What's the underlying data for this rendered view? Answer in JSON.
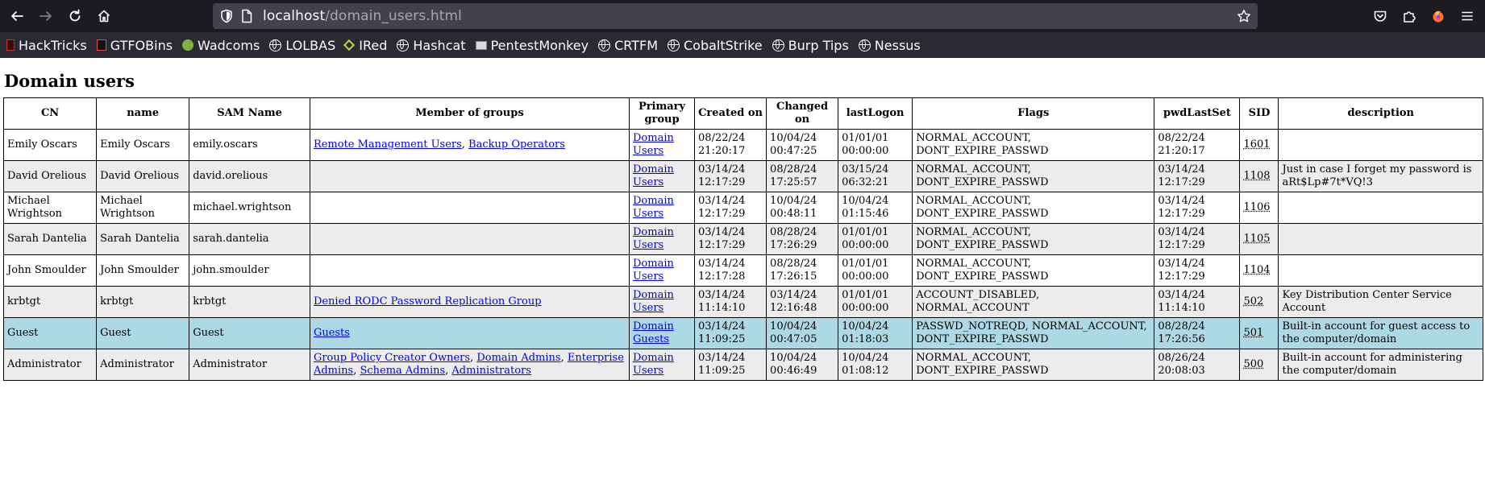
{
  "browser": {
    "url_host": "localhost",
    "url_path": "/domain_users.html",
    "bookmarks": [
      {
        "label": "HackTricks",
        "icon": "hacktricks-icon"
      },
      {
        "label": "GTFOBins",
        "icon": "gtfobins-icon"
      },
      {
        "label": "Wadcoms",
        "icon": "wadcoms-icon"
      },
      {
        "label": "LOLBAS",
        "icon": "globe-icon"
      },
      {
        "label": "IRed",
        "icon": "ired-icon"
      },
      {
        "label": "Hashcat",
        "icon": "globe-icon"
      },
      {
        "label": "PentestMonkey",
        "icon": "pentestmonkey-icon"
      },
      {
        "label": "CRTFM",
        "icon": "globe-icon"
      },
      {
        "label": "CobaltStrike",
        "icon": "globe-icon"
      },
      {
        "label": "Burp Tips",
        "icon": "globe-icon"
      },
      {
        "label": "Nessus",
        "icon": "globe-icon"
      }
    ]
  },
  "page": {
    "title": "Domain users",
    "columns": [
      "CN",
      "name",
      "SAM Name",
      "Member of groups",
      "Primary group",
      "Created on",
      "Changed on",
      "lastLogon",
      "Flags",
      "pwdLastSet",
      "SID",
      "description"
    ],
    "rows": [
      {
        "cn": "Emily Oscars",
        "name": "Emily Oscars",
        "sam": "emily.oscars",
        "groups": [
          "Remote Management Users",
          "Backup Operators"
        ],
        "primary": "Domain Users",
        "created": "08/22/24 21:20:17",
        "changed": "10/04/24 00:47:25",
        "lastlogon": "01/01/01 00:00:00",
        "flags": "NORMAL_ACCOUNT, DONT_EXPIRE_PASSWD",
        "pwdlastset": "08/22/24 21:20:17",
        "sid": "1601",
        "description": "",
        "style": "plain"
      },
      {
        "cn": "David Orelious",
        "name": "David Orelious",
        "sam": "david.orelious",
        "groups": [],
        "primary": "Domain Users",
        "created": "03/14/24 12:17:29",
        "changed": "08/28/24 17:25:57",
        "lastlogon": "03/15/24 06:32:21",
        "flags": "NORMAL_ACCOUNT, DONT_EXPIRE_PASSWD",
        "pwdlastset": "03/14/24 12:17:29",
        "sid": "1108",
        "description": "Just in case I forget my password is aRt$Lp#7t*VQ!3",
        "style": "alt"
      },
      {
        "cn": "Michael Wrightson",
        "name": "Michael Wrightson",
        "sam": "michael.wrightson",
        "groups": [],
        "primary": "Domain Users",
        "created": "03/14/24 12:17:29",
        "changed": "10/04/24 00:48:11",
        "lastlogon": "10/04/24 01:15:46",
        "flags": "NORMAL_ACCOUNT, DONT_EXPIRE_PASSWD",
        "pwdlastset": "03/14/24 12:17:29",
        "sid": "1106",
        "description": "",
        "style": "plain"
      },
      {
        "cn": "Sarah Dantelia",
        "name": "Sarah Dantelia",
        "sam": "sarah.dantelia",
        "groups": [],
        "primary": "Domain Users",
        "created": "03/14/24 12:17:29",
        "changed": "08/28/24 17:26:29",
        "lastlogon": "01/01/01 00:00:00",
        "flags": "NORMAL_ACCOUNT, DONT_EXPIRE_PASSWD",
        "pwdlastset": "03/14/24 12:17:29",
        "sid": "1105",
        "description": "",
        "style": "alt"
      },
      {
        "cn": "John Smoulder",
        "name": "John Smoulder",
        "sam": "john.smoulder",
        "groups": [],
        "primary": "Domain Users",
        "created": "03/14/24 12:17:28",
        "changed": "08/28/24 17:26:15",
        "lastlogon": "01/01/01 00:00:00",
        "flags": "NORMAL_ACCOUNT, DONT_EXPIRE_PASSWD",
        "pwdlastset": "03/14/24 12:17:29",
        "sid": "1104",
        "description": "",
        "style": "plain"
      },
      {
        "cn": "krbtgt",
        "name": "krbtgt",
        "sam": "krbtgt",
        "groups": [
          "Denied RODC Password Replication Group"
        ],
        "primary": "Domain Users",
        "created": "03/14/24 11:14:10",
        "changed": "03/14/24 12:16:48",
        "lastlogon": "01/01/01 00:00:00",
        "flags": "ACCOUNT_DISABLED, NORMAL_ACCOUNT",
        "pwdlastset": "03/14/24 11:14:10",
        "sid": "502",
        "description": "Key Distribution Center Service Account",
        "style": "alt"
      },
      {
        "cn": "Guest",
        "name": "Guest",
        "sam": "Guest",
        "groups": [
          "Guests"
        ],
        "primary": "Domain Guests",
        "created": "03/14/24 11:09:25",
        "changed": "10/04/24 00:47:05",
        "lastlogon": "10/04/24 01:18:03",
        "flags": "PASSWD_NOTREQD, NORMAL_ACCOUNT, DONT_EXPIRE_PASSWD",
        "pwdlastset": "08/28/24 17:26:56",
        "sid": "501",
        "description": "Built-in account for guest access to the computer/domain",
        "style": "hl"
      },
      {
        "cn": "Administrator",
        "name": "Administrator",
        "sam": "Administrator",
        "groups": [
          "Group Policy Creator Owners",
          "Domain Admins",
          "Enterprise Admins",
          "Schema Admins",
          "Administrators"
        ],
        "primary": "Domain Users",
        "created": "03/14/24 11:09:25",
        "changed": "10/04/24 00:46:49",
        "lastlogon": "10/04/24 01:08:12",
        "flags": "NORMAL_ACCOUNT, DONT_EXPIRE_PASSWD",
        "pwdlastset": "08/26/24 20:08:03",
        "sid": "500",
        "description": "Built-in account for administering the computer/domain",
        "style": "alt"
      }
    ]
  },
  "colors": {
    "toolbar_bg": "#1c1b22",
    "urlbar_bg": "#42414d",
    "bookmarks_bg": "#2b2a33",
    "link": "#0000ee",
    "row_alt": "#ececec",
    "row_highlight": "#add8e6"
  }
}
